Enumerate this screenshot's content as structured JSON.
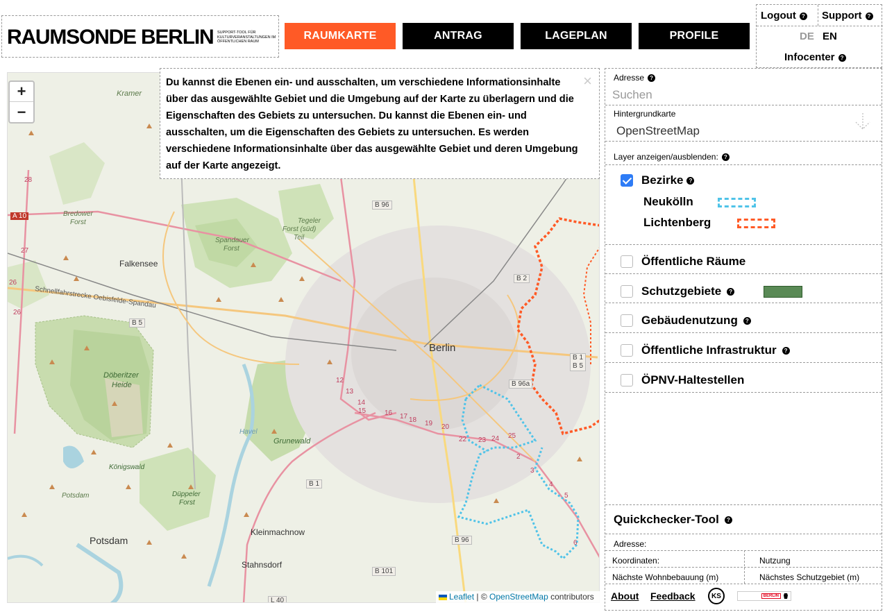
{
  "header": {
    "logo_title": "RAUMSONDE BERLIN",
    "logo_subtitle": "SUPPORT-TOOL FÜR KULTURVERANSTALTUNGEN IM ÖFFENTLICHEN RAUM",
    "nav": [
      {
        "label": "RAUMKARTE",
        "active": true
      },
      {
        "label": "ANTRAG",
        "active": false
      },
      {
        "label": "LAGEPLAN",
        "active": false
      },
      {
        "label": "PROFILE",
        "active": false
      }
    ],
    "logout": "Logout",
    "support": "Support",
    "lang_de": "DE",
    "lang_en": "EN",
    "infocenter": "Infocenter",
    "help_glyph": "?"
  },
  "map": {
    "zoom_in": "+",
    "zoom_out": "−",
    "info_text": "Du kannst die Ebenen ein- und ausschalten, um verschiedene Informationsinhalte über das ausgewählte Gebiet und die Umgebung auf der Karte zu überlagern und die Eigenschaften des Gebiets zu untersuchen. Du kannst die Ebenen ein- und ausschalten, um die Eigenschaften des Gebiets zu untersuchen. Es werden verschiedene Informationsinhalte über das ausgewählte Gebiet und deren Umgebung auf der Karte angezeigt.",
    "close_glyph": "×",
    "attribution_leaflet": "Leaflet",
    "attribution_sep": "|",
    "attribution_copy": "©",
    "attribution_osm": "OpenStreetMap",
    "attribution_suffix": "contributors",
    "labels": {
      "berlin": "Berlin",
      "falkensee": "Falkensee",
      "potsdam": "Potsdam",
      "kleinmachnow": "Kleinmachnow",
      "stahnsdorf": "Stahnsdorf",
      "kramer": "Kramer",
      "bredower": "Bredower",
      "forst1": "Forst",
      "tegeler": "Tegeler",
      "forst_sued": "Forst (süd)",
      "teil": "Teil",
      "spandauer": "Spandauer",
      "forst2": "Forst",
      "doeberitzer": "Döberitzer",
      "heide": "Heide",
      "grunewald": "Grunewald",
      "koenigswald": "Königswald",
      "duppeler": "Düppeler",
      "forst3": "Forst",
      "potsdam2": "Potsdam",
      "schnellfahr": "Schnellfahrstrecke Oebisfelde-Spandau",
      "havel": "Havel",
      "b96": "B 96",
      "b2": "B 2",
      "b5": "B 5",
      "b1": "B 1",
      "b1b5a": "B 1",
      "b1b5b": "B 5",
      "b96a": "B 96a",
      "b101": "B 101",
      "b96b": "B 96",
      "l40": "L 40",
      "a10": "A 10",
      "n28": "28",
      "n27": "27",
      "n26a": "26",
      "n26b": "26",
      "n12": "12",
      "n13": "13",
      "n14": "14",
      "n15": "15",
      "n16": "16",
      "n17": "17",
      "n18": "18",
      "n19": "19",
      "n20": "20",
      "n22": "22",
      "n23": "23",
      "n24": "24",
      "n25": "25",
      "n2a": "2",
      "n3": "3",
      "n4": "4",
      "n5": "5",
      "n6": "6"
    }
  },
  "panel": {
    "address_label": "Adresse",
    "address_placeholder": "Suchen",
    "basemap_label": "Hintergrundkarte",
    "basemap_value": "OpenStreetMap",
    "layers_label": "Layer anzeigen/ausblenden:",
    "layers": [
      {
        "label": "Bezirke",
        "checked": true,
        "help": true
      },
      {
        "label": "Öffentliche Räume",
        "checked": false,
        "help": false
      },
      {
        "label": "Schutzgebiete",
        "checked": false,
        "help": true
      },
      {
        "label": "Gebäudenutzung",
        "checked": false,
        "help": true
      },
      {
        "label": "Öffentliche Infrastruktur",
        "checked": false,
        "help": true
      },
      {
        "label": "ÖPNV-Haltestellen",
        "checked": false,
        "help": false
      }
    ],
    "districts": [
      {
        "label": "Neukölln",
        "color": "#4fc3e8"
      },
      {
        "label": "Lichtenberg",
        "color": "#ff5a26"
      }
    ],
    "schutz_color": "#5a8a56",
    "quickchecker_title": "Quickchecker-Tool",
    "qc_address": "Adresse:",
    "qc_coords": "Koordinaten:",
    "qc_usage": "Nutzung",
    "qc_nearest_housing": "Nächste Wohnbebauung (m)",
    "qc_nearest_protected": "Nächstes Schutzgebiet (m)",
    "footer_about": "About",
    "footer_feedback": "Feedback",
    "footer_ks": "KS",
    "footer_berlin": "BERLIN"
  }
}
